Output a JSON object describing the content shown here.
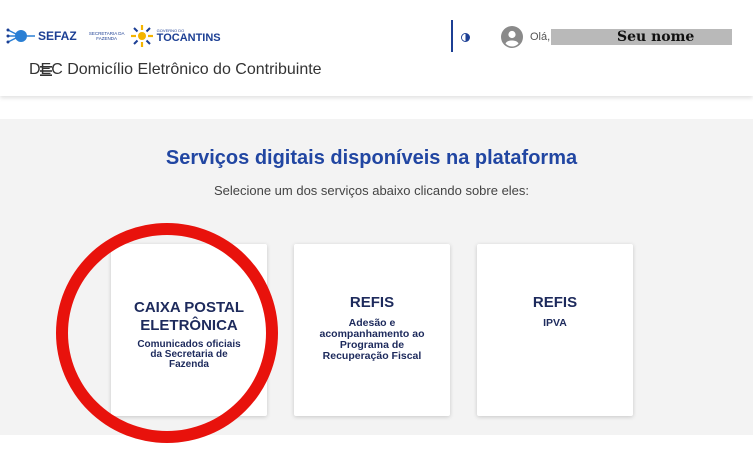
{
  "header": {
    "sefaz_logo": "SEFAZ",
    "secretaria_logo": "SECRETARIA DA FAZENDA",
    "governo_label": "GOVERNO DO",
    "tocantins_logo": "TOCANTINS",
    "contrast_icon": "contrast-icon",
    "greeting": "Olá,",
    "user_name": "Seu nome",
    "app_title": "DEC Domicílio Eletrônico do Contribuinte",
    "menu_icon": "hamburger-menu-icon"
  },
  "main": {
    "title": "Serviços digitais disponíveis na plataforma",
    "subtitle": "Selecione um dos serviços abaixo clicando sobre eles:",
    "cards": [
      {
        "title_line1": "CAIXA POSTAL",
        "title_line2": "ELETRÔNICA",
        "desc_line1": "Comunicados oficiais",
        "desc_line2": "da Secretaria de",
        "desc_line3": "Fazenda"
      },
      {
        "title_line1": "REFIS",
        "desc_line1": "Adesão e",
        "desc_line2": "acompanhamento ao",
        "desc_line3": "Programa de",
        "desc_line4": "Recuperação Fiscal"
      },
      {
        "title_line1": "REFIS",
        "desc_line1": "IPVA"
      }
    ]
  },
  "colors": {
    "brand_blue": "#2146a2",
    "card_text": "#1d2a5c",
    "highlight_red": "#e8120c",
    "background_gray": "#f3f3f3"
  }
}
